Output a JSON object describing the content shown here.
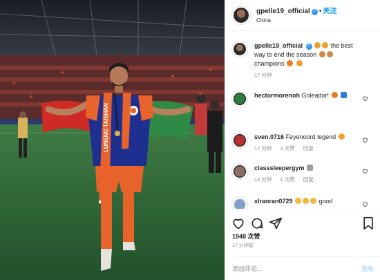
{
  "post": {
    "username": "gpelle19_official",
    "follow_label": "关注",
    "dot": "•",
    "location": "China"
  },
  "caption": {
    "username": "gpelle19_official",
    "text_1": "the best way to",
    "text_2": "end the season",
    "text_3": "champions",
    "time": "17 分钟"
  },
  "comments": [
    {
      "username": "hectormorenoh",
      "text": "Goleador!",
      "time": "",
      "likes": "",
      "reply": ""
    },
    {
      "username": "sven.0716",
      "text": "Feyenoord legend",
      "time": "17 分钟",
      "likes": "3 次赞",
      "reply": "回复"
    },
    {
      "username": "classsleepergym",
      "text": "",
      "time": "14 分钟",
      "likes": "1 次赞",
      "reply": "回复"
    },
    {
      "username": "xlranran0729",
      "text": "good",
      "time": "",
      "likes": "",
      "reply": ""
    }
  ],
  "likes_count": "1948 次赞",
  "post_age": "17 分钟前",
  "comment_box": {
    "placeholder": "添加评论...",
    "post_label": "发布"
  },
  "jersey_text": "LUNENG TAISHAN",
  "colors": {
    "accent": "#0095f6",
    "jersey_blue": "#1d2f8f",
    "jersey_orange": "#e8632b",
    "pitch": "#2e6a3a"
  },
  "icons": [
    "heart-icon",
    "comment-icon",
    "share-icon",
    "bookmark-icon",
    "verified-icon"
  ]
}
